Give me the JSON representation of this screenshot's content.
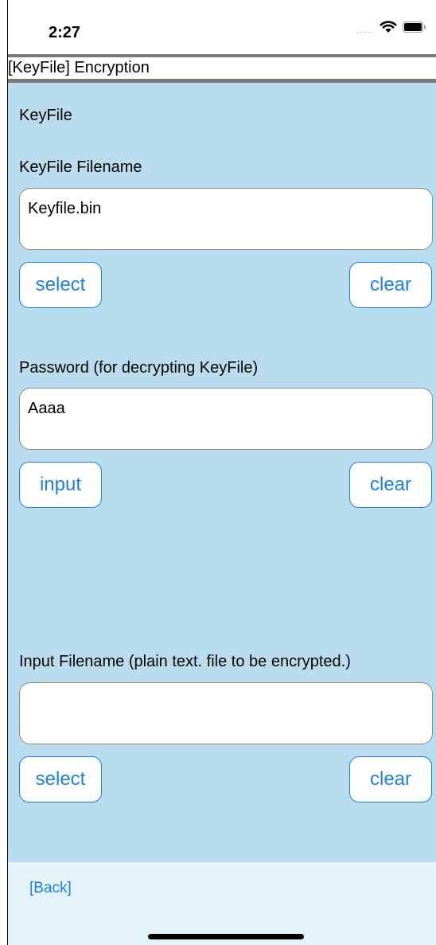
{
  "status_bar": {
    "time": "2:27",
    "signal_dots": "....."
  },
  "title": "[KeyFile] Encryption",
  "sections": {
    "section_title": "KeyFile",
    "keyfile_filename": {
      "label": "KeyFile Filename",
      "value": "Keyfile.bin",
      "select_label": "select",
      "clear_label": "clear"
    },
    "password": {
      "label": "Password (for decrypting KeyFile)",
      "value": "Aaaa",
      "input_label": "input",
      "clear_label": "clear"
    },
    "input_filename": {
      "label": "Input Filename (plain text. file to be encrypted.)",
      "value": "",
      "select_label": "select",
      "clear_label": "clear"
    }
  },
  "bottom_bar": {
    "back_label": "[Back]"
  },
  "colors": {
    "accent": "#1a7ef0",
    "content_bg": "#b9dcee",
    "bottom_bg": "#e4f2f9"
  }
}
